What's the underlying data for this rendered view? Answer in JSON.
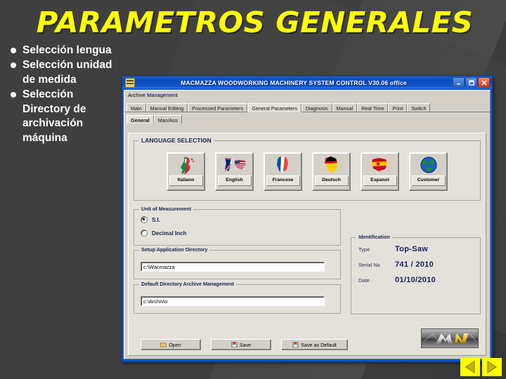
{
  "slide": {
    "title": "PARAMETROS GENERALES",
    "bullets": [
      "Selección lengua",
      "Selección unidad de medida",
      "Selección Directory de archivación máquina"
    ],
    "title_color": "#FFFF00",
    "background_color": "#3f3f3f"
  },
  "app": {
    "titlebar": {
      "title": "MACMAZZA WOODWORKING MACHINERY SYSTEM CONTROL  V30.06 office",
      "minimize": "_",
      "maximize": "□",
      "close": "✕"
    },
    "menu": {
      "archive_management": "Archive Management"
    },
    "tabs": [
      {
        "label": "Main",
        "selected": false
      },
      {
        "label": "Manual Editing",
        "selected": false
      },
      {
        "label": "Processed Parameters",
        "selected": false
      },
      {
        "label": "General Parameters",
        "selected": true
      },
      {
        "label": "Diagnosis",
        "selected": false
      },
      {
        "label": "Manual",
        "selected": false
      },
      {
        "label": "Real Time",
        "selected": false
      },
      {
        "label": "Print",
        "selected": false
      },
      {
        "label": "Switch",
        "selected": false
      }
    ],
    "subtabs": [
      {
        "label": "General",
        "selected": true
      },
      {
        "label": "Man/Ass",
        "selected": false
      }
    ],
    "language_selection": {
      "group_label": "LANGUAGE SELECTION",
      "buttons": [
        {
          "label": "Italiano",
          "flag": "italy-flag-icon"
        },
        {
          "label": "English",
          "flag": "uk-usa-flag-icon"
        },
        {
          "label": "Francese",
          "flag": "france-flag-icon"
        },
        {
          "label": "Deutsch",
          "flag": "germany-flag-icon"
        },
        {
          "label": "Espanol",
          "flag": "spain-flag-icon"
        },
        {
          "label": "Customer",
          "flag": "globe-icon"
        }
      ]
    },
    "unit_of_measurement": {
      "group_label": "Unit of Measurement",
      "options": [
        {
          "label": "S.I.",
          "selected": true
        },
        {
          "label": "Decimal Inch",
          "selected": false
        }
      ]
    },
    "setup_application_directory": {
      "group_label": "Setup Application Directory",
      "value": "c:\\Wacmazza"
    },
    "default_directory_archive_management": {
      "group_label": "Default Directory Archive Management",
      "value": "c:\\Archivio"
    },
    "identification": {
      "group_label": "Identification",
      "rows": [
        {
          "key": "Type",
          "value": "Top-Saw"
        },
        {
          "key": "Serial No",
          "value": "741 / 2010"
        },
        {
          "key": "Date",
          "value": "01/10/2010"
        }
      ]
    },
    "buttons": [
      {
        "label": "Open",
        "icon": "open-folder-icon"
      },
      {
        "label": "Save",
        "icon": "save-disk-icon"
      },
      {
        "label": "Save as Default",
        "icon": "save-disk-icon"
      }
    ],
    "logo": "mn-logo"
  },
  "navigation": {
    "previous": "prev-arrow-icon",
    "next": "next-arrow-icon"
  }
}
